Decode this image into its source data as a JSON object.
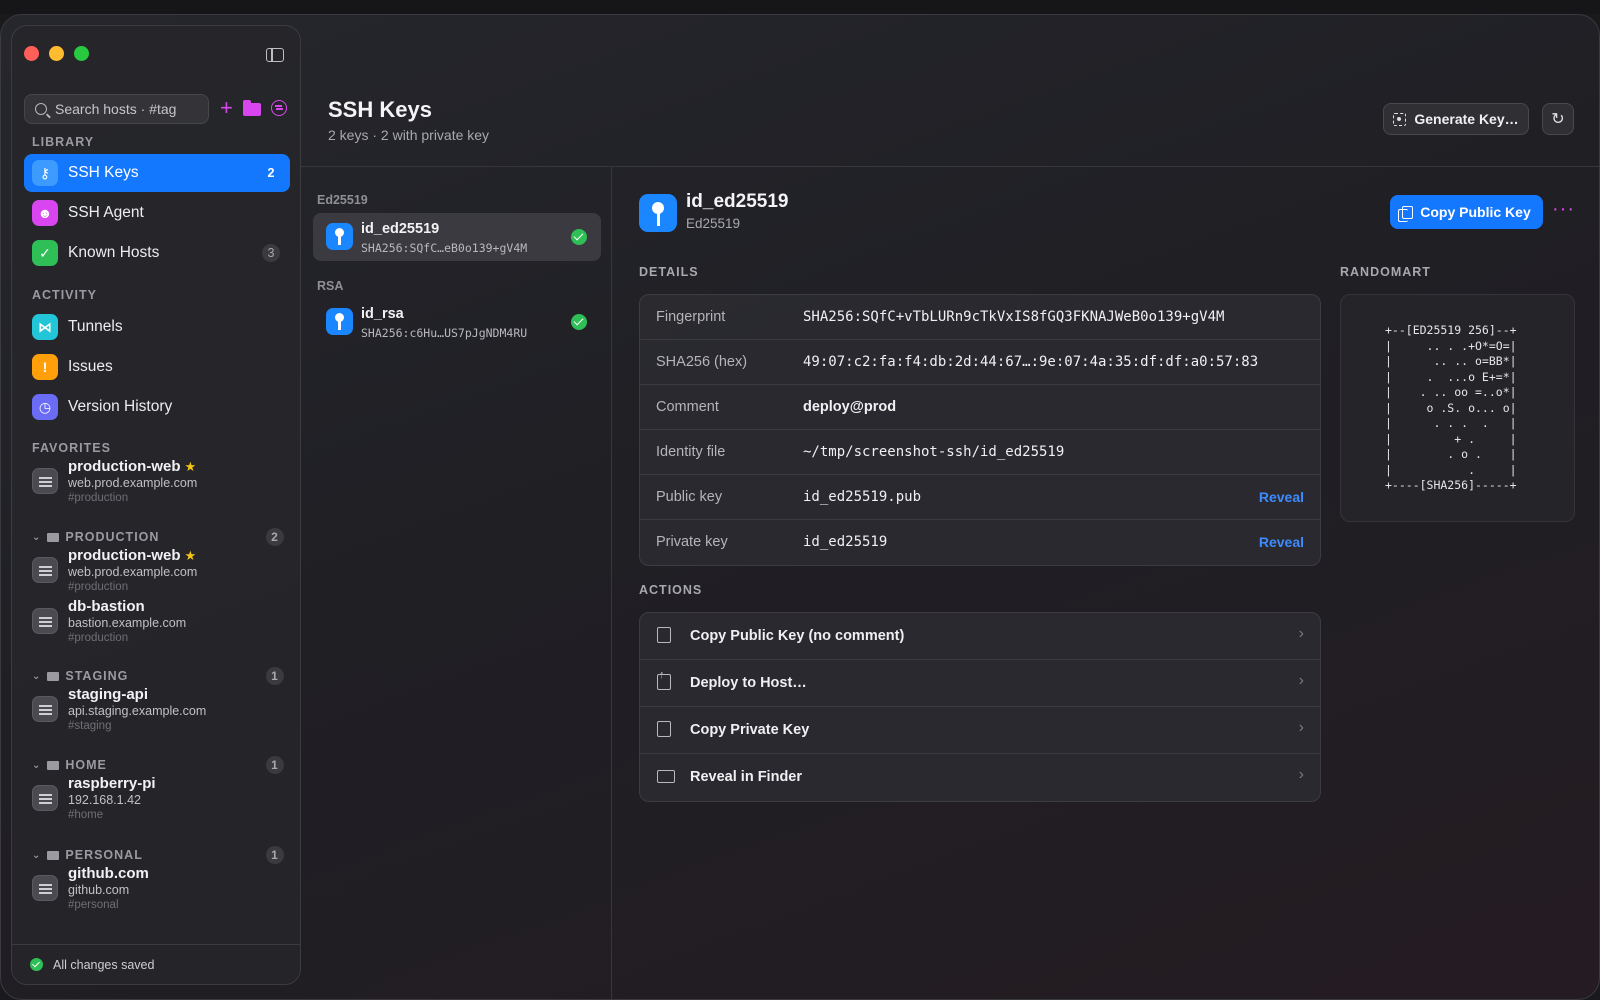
{
  "sidebar": {
    "search_placeholder": "Search hosts · #tag",
    "library_label": "LIBRARY",
    "library": [
      {
        "label": "SSH Keys",
        "count": "2"
      },
      {
        "label": "SSH Agent",
        "count": ""
      },
      {
        "label": "Known Hosts",
        "count": "3"
      }
    ],
    "activity_label": "ACTIVITY",
    "activity": [
      {
        "label": "Tunnels"
      },
      {
        "label": "Issues"
      },
      {
        "label": "Version History"
      }
    ],
    "favorites_label": "FAVORITES",
    "favorites": [
      {
        "name": "production-web",
        "address": "web.prod.example.com",
        "tag": "#production"
      }
    ],
    "groups": [
      {
        "name": "PRODUCTION",
        "count": "2",
        "hosts": [
          {
            "name": "production-web",
            "address": "web.prod.example.com",
            "tag": "#production"
          },
          {
            "name": "db-bastion",
            "address": "bastion.example.com",
            "tag": "#production"
          }
        ]
      },
      {
        "name": "STAGING",
        "count": "1",
        "hosts": [
          {
            "name": "staging-api",
            "address": "api.staging.example.com",
            "tag": "#staging"
          }
        ]
      },
      {
        "name": "HOME",
        "count": "1",
        "hosts": [
          {
            "name": "raspberry-pi",
            "address": "192.168.1.42",
            "tag": "#home"
          }
        ]
      },
      {
        "name": "PERSONAL",
        "count": "1",
        "hosts": [
          {
            "name": "github.com",
            "address": "github.com",
            "tag": "#personal"
          }
        ]
      }
    ],
    "status": "All changes saved"
  },
  "header": {
    "title": "SSH Keys",
    "subtitle": "2 keys · 2 with private key",
    "generate_label": "Generate Key…",
    "refresh_icon": "refresh-icon"
  },
  "keylist": {
    "sections": [
      {
        "label": "Ed25519",
        "keys": [
          {
            "name": "id_ed25519",
            "fingerprint": "SHA256:SQfC…eB0o139+gV4M"
          }
        ]
      },
      {
        "label": "RSA",
        "keys": [
          {
            "name": "id_rsa",
            "fingerprint": "SHA256:c6Hu…US7pJgNDM4RU"
          }
        ]
      }
    ]
  },
  "detail": {
    "name": "id_ed25519",
    "type": "Ed25519",
    "copy_label": "Copy Public Key",
    "more": "···",
    "details_label": "DETAILS",
    "rows": [
      {
        "key": "Fingerprint",
        "value": "SHA256:SQfC+vTbLURn9cTkVxIS8fGQ3FKNAJWeB0o139+gV4M"
      },
      {
        "key": "SHA256 (hex)",
        "value": "49:07:c2:fa:f4:db:2d:44:67…:9e:07:4a:35:df:df:a0:57:83"
      },
      {
        "key": "Comment",
        "value": "deploy@prod"
      },
      {
        "key": "Identity file",
        "value": "~/tmp/screenshot-ssh/id_ed25519"
      },
      {
        "key": "Public key",
        "value": "id_ed25519.pub",
        "action": "Reveal"
      },
      {
        "key": "Private key",
        "value": "id_ed25519",
        "action": "Reveal"
      }
    ],
    "randomart_label": "RANDOMART",
    "randomart": "+--[ED25519 256]--+\n|     .. . .+O*=O=|\n|      .. .. o=BB*|\n|     .  ...o E+=*|\n|    . .. oo =..o*|\n|     o .S. o... o|\n|      . . .  .   |\n|         + .     |\n|        . o .    |\n|           .     |\n+----[SHA256]-----+",
    "actions_label": "ACTIONS",
    "actions": [
      {
        "label": "Copy Public Key (no comment)"
      },
      {
        "label": "Deploy to Host…"
      },
      {
        "label": "Copy Private Key"
      },
      {
        "label": "Reveal in Finder"
      }
    ]
  },
  "colors": {
    "accent": "#1478ff",
    "magenta": "#d946ef",
    "success": "#2fbf57"
  }
}
